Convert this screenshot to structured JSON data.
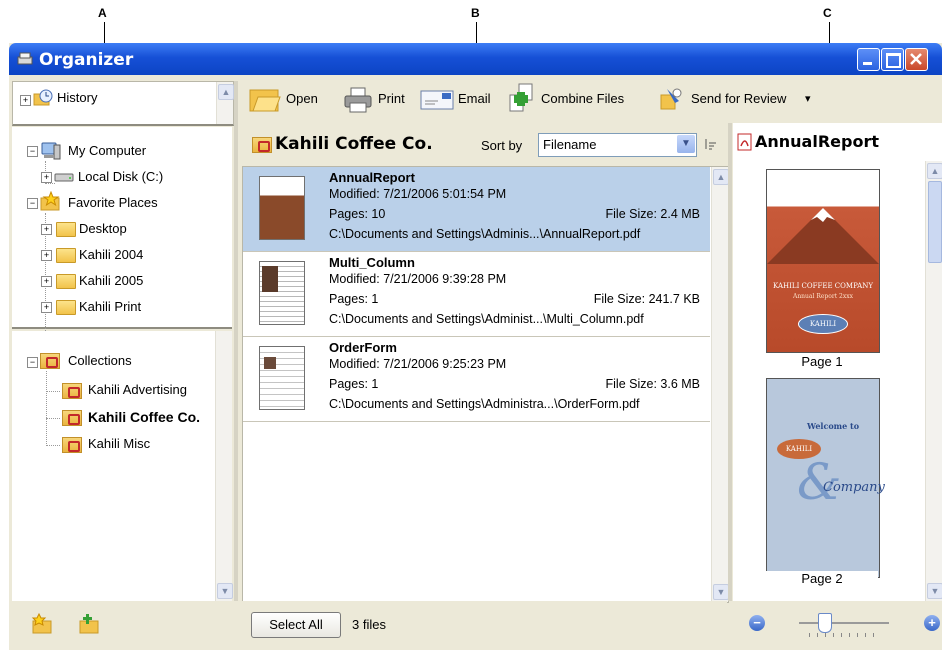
{
  "callouts": [
    "A",
    "B",
    "C"
  ],
  "window": {
    "title": "Organizer"
  },
  "left": {
    "history_label": "History",
    "tree": [
      {
        "label": "My Computer",
        "expander": "−"
      },
      {
        "label": "Local Disk (C:)",
        "expander": "+"
      },
      {
        "label": "Favorite Places",
        "expander": "−"
      },
      {
        "label": "Desktop",
        "expander": "+"
      },
      {
        "label": "Kahili 2004",
        "expander": "+"
      },
      {
        "label": "Kahili 2005",
        "expander": "+"
      },
      {
        "label": "Kahili Print",
        "expander": "+"
      }
    ],
    "collections_label": "Collections",
    "collections": [
      "Kahili Advertising",
      "Kahili Coffee Co.",
      "Kahili Misc"
    ],
    "selected_collection": "Kahili Coffee Co."
  },
  "toolbar": {
    "open": "Open",
    "print": "Print",
    "email": "Email",
    "combine": "Combine Files",
    "send": "Send for Review",
    "send_arrow": "▾"
  },
  "middle": {
    "folder_title": "Kahili Coffee Co.",
    "sort_label": "Sort by",
    "sort_value": "Filename",
    "files": [
      {
        "name": "AnnualReport",
        "modified": "Modified: 7/21/2006 5:01:54 PM",
        "pages": "Pages: 10",
        "size": "File Size: 2.4 MB",
        "path": "C:\\Documents and Settings\\Adminis...\\AnnualReport.pdf"
      },
      {
        "name": "Multi_Column",
        "modified": "Modified: 7/21/2006 9:39:28 PM",
        "pages": "Pages: 1",
        "size": "File Size: 241.7 KB",
        "path": "C:\\Documents and Settings\\Administ...\\Multi_Column.pdf"
      },
      {
        "name": "OrderForm",
        "modified": "Modified: 7/21/2006 9:25:23 PM",
        "pages": "Pages: 1",
        "size": "File Size: 3.6 MB",
        "path": "C:\\Documents and Settings\\Administra...\\OrderForm.pdf"
      }
    ],
    "select_all": "Select All",
    "file_count": "3 files"
  },
  "preview": {
    "title": "AnnualReport",
    "pages": [
      {
        "label": "Page 1",
        "lines": [
          "KAHILI COFFEE COMPANY",
          "Annual Report 2xxx"
        ],
        "badge": "KAHILI"
      },
      {
        "label": "Page 2",
        "lines": [
          "Welcome to",
          "Company"
        ],
        "badge": "KAHILI"
      }
    ]
  },
  "colors": {
    "selection": "#bad0e9",
    "titlebar": "#0c44c4",
    "chrome": "#ece9d8"
  }
}
